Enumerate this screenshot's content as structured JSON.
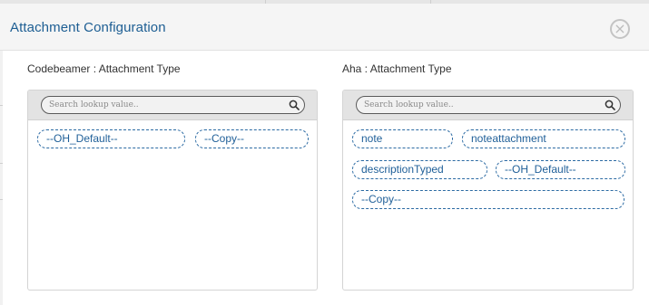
{
  "dialog": {
    "title": "Attachment Configuration",
    "close_symbol": "×"
  },
  "left": {
    "label": "Codebeamer : Attachment Type",
    "search_placeholder": "Search lookup value..",
    "chips": [
      "--OH_Default--",
      "--Copy--"
    ]
  },
  "right": {
    "label": "Aha : Attachment Type",
    "search_placeholder": "Search lookup value..",
    "chips": [
      "note",
      "noteattachment",
      "descriptionTyped",
      "--OH_Default--",
      "--Copy--"
    ]
  },
  "colors": {
    "title": "#1d5e93",
    "chip_border": "#2b6aa3",
    "chip_text": "#1f5f98",
    "header_bg": "#f5f5f5",
    "panel_head_bg": "#e3e3e3"
  }
}
